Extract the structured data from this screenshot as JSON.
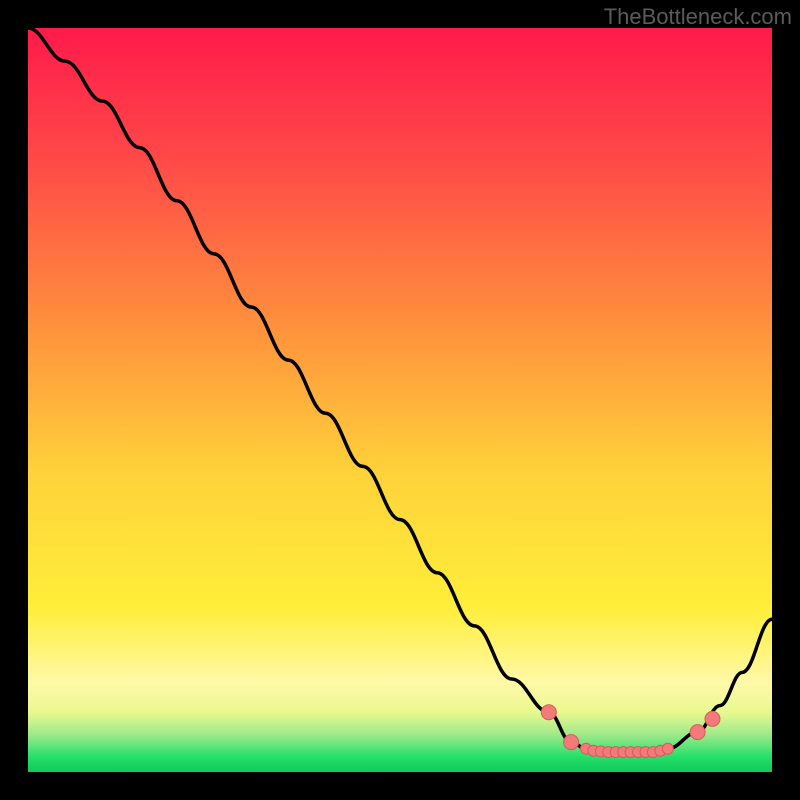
{
  "watermark": "TheBottleneck.com",
  "colors": {
    "black": "#000000",
    "red_top": "#ff1a4b",
    "orange": "#ff8a3d",
    "yellow_mid": "#ffe83d",
    "yellow_pale": "#fff9b0",
    "green": "#23e06a",
    "curve": "#000000",
    "marker_fill": "#f47a7a",
    "marker_stroke": "#d85a5a"
  },
  "chart_data": {
    "type": "line",
    "title": "",
    "xlabel": "",
    "ylabel": "",
    "x": [
      0,
      5,
      10,
      15,
      20,
      25,
      30,
      35,
      40,
      45,
      50,
      55,
      60,
      65,
      70,
      73,
      75,
      78,
      80,
      82,
      84,
      86,
      90,
      93,
      96,
      100
    ],
    "values_pct": [
      112,
      107,
      101,
      94,
      86,
      78,
      70,
      62,
      54,
      46,
      38,
      30,
      22,
      14,
      9,
      4.5,
      3.5,
      3.0,
      3.0,
      3.0,
      3.0,
      3.5,
      6,
      10,
      15,
      23
    ],
    "ylim": [
      0,
      112
    ],
    "markers_x": [
      70,
      73,
      75,
      76,
      77,
      78,
      79,
      80,
      81,
      82,
      83,
      84,
      85,
      86,
      90,
      92
    ],
    "markers_y_pct": [
      9,
      4.5,
      3.5,
      3.2,
      3.1,
      3.0,
      3.0,
      3.0,
      3.0,
      3.0,
      3.0,
      3.0,
      3.2,
      3.5,
      6,
      8
    ],
    "note": "x is 0-100 across the plot width; values_pct is 0-112 percent of plot height from the bottom baseline; estimated from pixels."
  },
  "gradient_bands_pct": [
    {
      "from": 0.0,
      "to": 18.0,
      "c0": "#ff1a4b",
      "c1": "#ff4a48"
    },
    {
      "from": 18.0,
      "to": 38.0,
      "c0": "#ff4a48",
      "c1": "#ff8a3d"
    },
    {
      "from": 38.0,
      "to": 60.0,
      "c0": "#ff8a3d",
      "c1": "#ffd23a"
    },
    {
      "from": 60.0,
      "to": 78.0,
      "c0": "#ffd23a",
      "c1": "#ffee3a"
    },
    {
      "from": 78.0,
      "to": 88.0,
      "c0": "#ffee3a",
      "c1": "#fff9a8"
    },
    {
      "from": 88.0,
      "to": 92.0,
      "c0": "#fff9a8",
      "c1": "#e9f98f"
    },
    {
      "from": 92.0,
      "to": 95.0,
      "c0": "#e9f98f",
      "c1": "#9de98a"
    },
    {
      "from": 95.0,
      "to": 98.0,
      "c0": "#9de98a",
      "c1": "#23e06a"
    },
    {
      "from": 98.0,
      "to": 100.0,
      "c0": "#23e06a",
      "c1": "#11c85a"
    }
  ]
}
